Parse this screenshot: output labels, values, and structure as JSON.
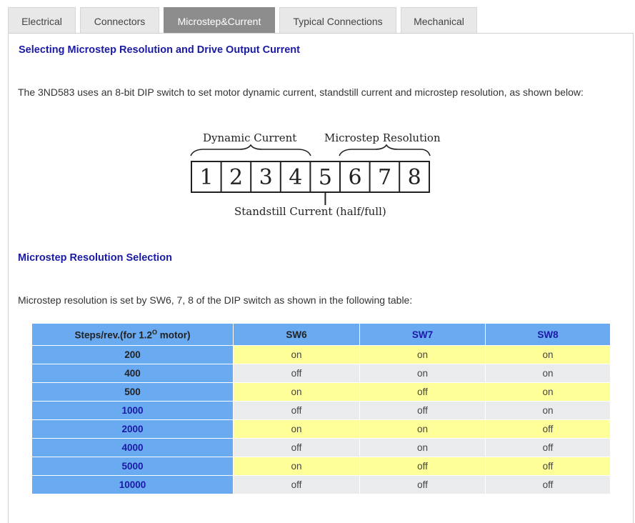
{
  "tabs": [
    {
      "label": "Electrical"
    },
    {
      "label": "Connectors"
    },
    {
      "label": "Microstep&Current"
    },
    {
      "label": "Typical Connections"
    },
    {
      "label": "Mechanical"
    }
  ],
  "section1": {
    "heading": "Selecting Microstep Resolution and Drive Output Current",
    "paragraph": "The 3ND583 uses an 8-bit DIP switch to set motor dynamic current, standstill current and microstep resolution, as shown below:"
  },
  "diagram": {
    "dynamic_label": "Dynamic Current",
    "microstep_label": "Microstep Resolution",
    "standstill_label": "Standstill Current (half/full)",
    "switches": [
      "1",
      "2",
      "3",
      "4",
      "5",
      "6",
      "7",
      "8"
    ]
  },
  "section2": {
    "heading": "Microstep Resolution Selection",
    "paragraph": "Microstep resolution is set by SW6, 7, 8 of the DIP switch as shown in the following table:"
  },
  "table": {
    "header_steps": "Steps/rev.(for 1.2",
    "header_steps_sup": "O",
    "header_steps_suffix": " motor)",
    "header_sw6": "SW6",
    "header_sw7": "SW7",
    "header_sw8": "SW8",
    "rows": [
      {
        "steps": "200",
        "sw6": "on",
        "sw7": "on",
        "sw8": "on"
      },
      {
        "steps": "400",
        "sw6": "off",
        "sw7": "on",
        "sw8": "on"
      },
      {
        "steps": "500",
        "sw6": "on",
        "sw7": "off",
        "sw8": "on"
      },
      {
        "steps": "1000",
        "sw6": "off",
        "sw7": "off",
        "sw8": "on"
      },
      {
        "steps": "2000",
        "sw6": "on",
        "sw7": "on",
        "sw8": "off"
      },
      {
        "steps": "4000",
        "sw6": "off",
        "sw7": "on",
        "sw8": "off"
      },
      {
        "steps": "5000",
        "sw6": "on",
        "sw7": "off",
        "sw8": "off"
      },
      {
        "steps": "10000",
        "sw6": "off",
        "sw7": "off",
        "sw8": "off"
      }
    ]
  },
  "colors": {
    "heading": "#1a1aa6",
    "header_cell": "#6aaaf0",
    "row_yellow": "#ffff9a",
    "row_grey": "#e9ebec",
    "active_tab": "#8c8c8c"
  }
}
